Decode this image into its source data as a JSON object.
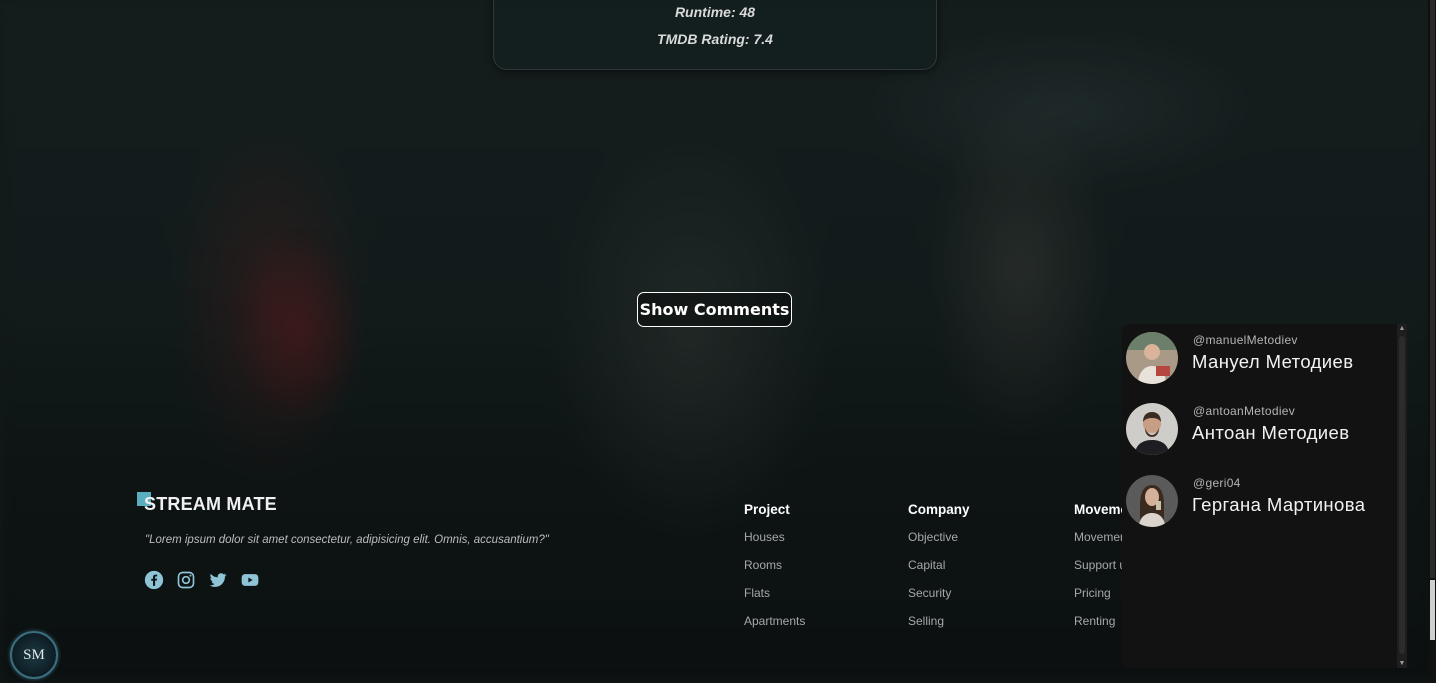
{
  "movie_info": {
    "runtime": "Runtime: 48",
    "rating": "TMDB Rating: 7.4"
  },
  "show_comments_label": "Show Comments",
  "footer": {
    "brand": "STREAM MATE",
    "tagline": "\"Lorem ipsum dolor sit amet consectetur, adipisicing elit. Omnis, accusantium?\"",
    "social_icons": [
      "facebook-icon",
      "instagram-icon",
      "twitter-icon",
      "youtube-icon"
    ],
    "columns": [
      {
        "title": "Project",
        "links": [
          "Houses",
          "Rooms",
          "Flats",
          "Apartments"
        ]
      },
      {
        "title": "Company",
        "links": [
          "Objective",
          "Capital",
          "Security",
          "Selling"
        ]
      },
      {
        "title": "Moveme",
        "links": [
          "Movemer",
          "Support u",
          "Pricing",
          "Renting"
        ]
      }
    ]
  },
  "logo_text": "SM",
  "friends": [
    {
      "handle": "@manuelMetodiev",
      "name": "Мануел Методиев"
    },
    {
      "handle": "@antoanMetodiev",
      "name": "Антоан Методиев"
    },
    {
      "handle": "@geri04",
      "name": "Гергана Мартинова"
    }
  ],
  "colors": {
    "accent": "#5aaec0",
    "social_icon": "#8fc3d6",
    "panel_bg": "#121212"
  }
}
